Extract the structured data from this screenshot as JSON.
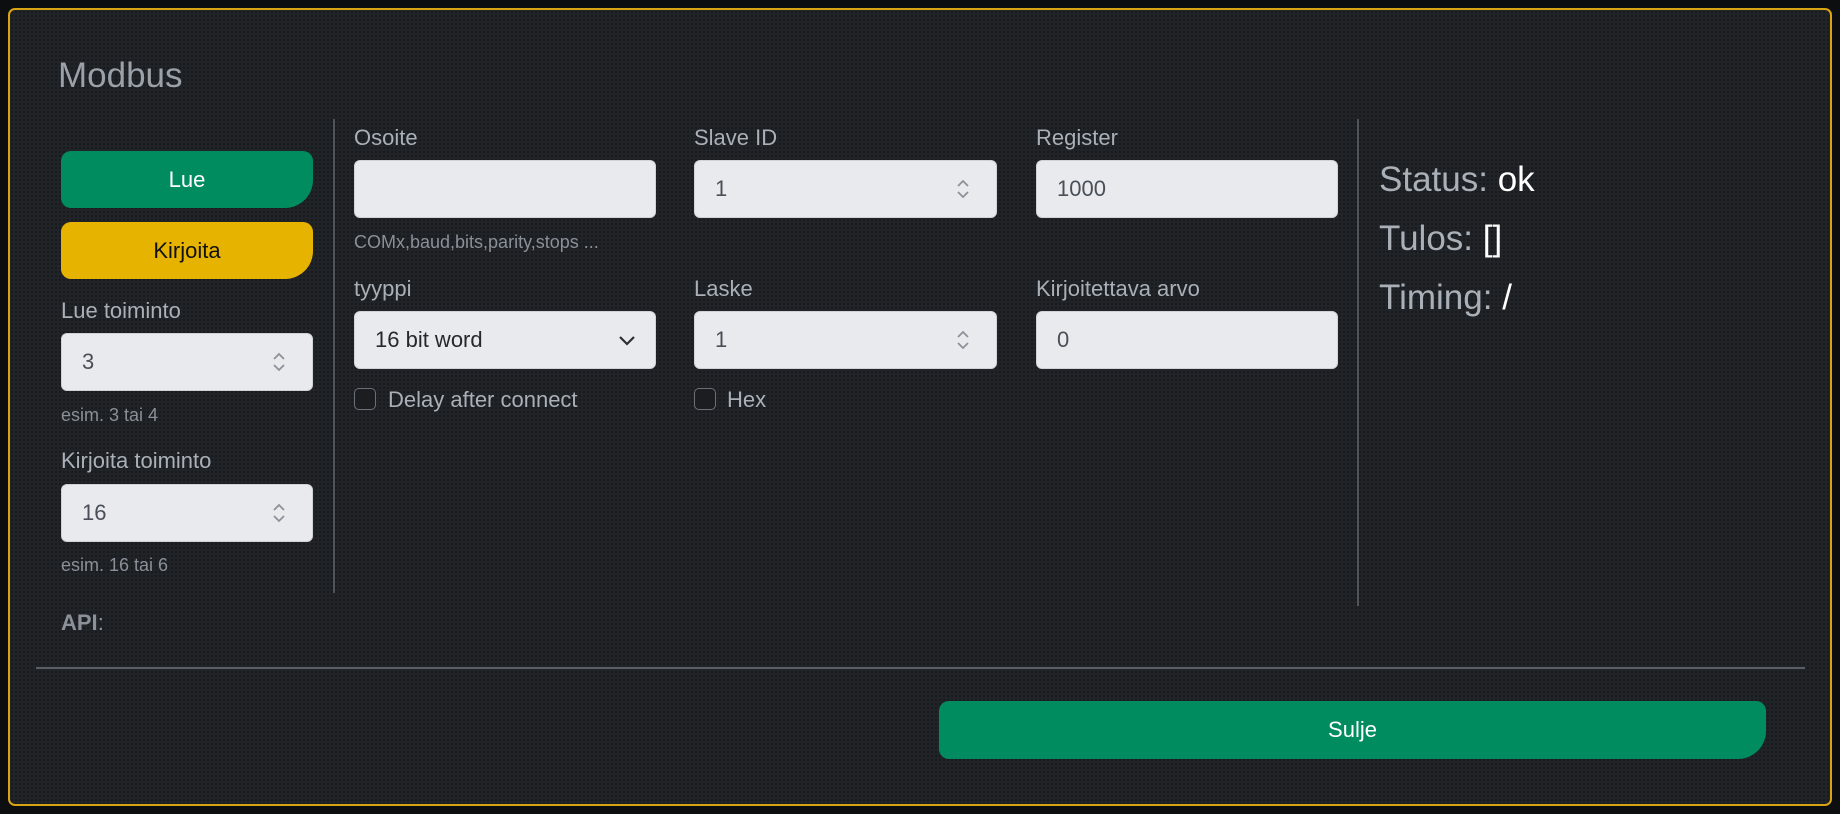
{
  "title": "Modbus",
  "left": {
    "read_button": "Lue",
    "write_button": "Kirjoita",
    "read_function": {
      "label": "Lue toiminto",
      "value": "3",
      "hint": "esim. 3 tai 4"
    },
    "write_function": {
      "label": "Kirjoita toiminto",
      "value": "16",
      "hint": "esim. 16 tai 6"
    }
  },
  "form": {
    "address": {
      "label": "Osoite",
      "value": "",
      "hint": "COMx,baud,bits,parity,stops ..."
    },
    "slave_id": {
      "label": "Slave ID",
      "value": "1"
    },
    "register": {
      "label": "Register",
      "value": "1000"
    },
    "type": {
      "label": "tyyppi",
      "selected": "16 bit word"
    },
    "count": {
      "label": "Laske",
      "value": "1"
    },
    "write_value": {
      "label": "Kirjoitettava arvo",
      "value": "0"
    },
    "delay_checkbox": {
      "label": "Delay after connect",
      "checked": false
    },
    "hex_checkbox": {
      "label": "Hex",
      "checked": false
    }
  },
  "result": {
    "status_label": "Status:",
    "status_value": "ok",
    "result_label": "Tulos:",
    "result_value": "[]",
    "timing_label": "Timing:",
    "timing_value": "/"
  },
  "api_label": "API",
  "api_colon": ":",
  "close_button": "Sulje",
  "colors": {
    "accent_green": "#008c5e",
    "accent_yellow": "#e6b400",
    "border_gold": "#d9a514"
  }
}
